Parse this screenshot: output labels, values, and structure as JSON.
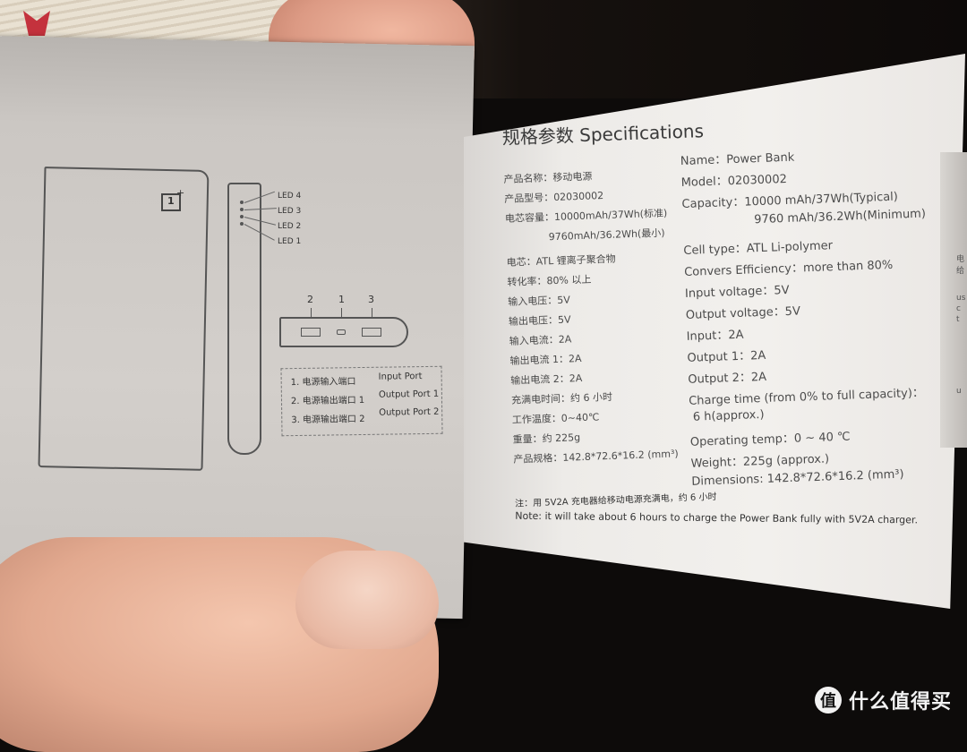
{
  "scene": {
    "description": "Hand holding an open OnePlus power bank manual booklet",
    "colors": {
      "paper": "#efece9",
      "ink": "#4a4a4a",
      "background": "#0d0b0a",
      "skin": "#e2a98f"
    }
  },
  "left_page": {
    "led_labels": [
      "LED 4",
      "LED 3",
      "LED 2",
      "LED 1"
    ],
    "port_numbers": [
      "2",
      "1",
      "3"
    ],
    "legend": [
      {
        "cn": "1. 电源输入端口",
        "en": "Input Port"
      },
      {
        "cn": "2. 电源输出端口 1",
        "en": "Output Port 1"
      },
      {
        "cn": "3. 电源输出端口 2",
        "en": "Output Port 2"
      }
    ],
    "logo_icon": "oneplus-logo-icon"
  },
  "right_page": {
    "title": "规格参数 Specifications",
    "cn_specs": [
      "产品名称：移动电源",
      "产品型号：02030002",
      "电芯容量：10000mAh/37Wh(标准)",
      "9760mAh/36.2Wh(最小)",
      "电芯：ATL 锂离子聚合物",
      "转化率：80% 以上",
      "输入电压：5V",
      "输出电压：5V",
      "输入电流：2A",
      "输出电流 1：2A",
      "输出电流 2：2A",
      "充满电时间：约 6 小时",
      "工作温度：0~40℃",
      "重量：约 225g",
      "产品规格：142.8*72.6*16.2 (mm³)"
    ],
    "en_specs": [
      "Name：Power Bank",
      "Model：02030002",
      "Capacity：10000 mAh/37Wh(Typical)",
      "9760 mAh/36.2Wh(Minimum)",
      "Cell type：ATL Li-polymer",
      "Convers Efficiency：more than 80%",
      "Input voltage：5V",
      "Output voltage：5V",
      "Input：2A",
      "Output 1：2A",
      "Output 2：2A",
      "Charge time (from 0% to full capacity)：",
      "6 h(approx.)",
      "Operating temp：0 ~ 40 ℃",
      "Weight：225g (approx.)",
      "Dimensions: 142.8*72.6*16.2 (mm³)"
    ],
    "note_cn": "注：用 5V2A 充电器给移动电源充满电，约 6 小时",
    "note_en": "Note: it will take about 6 hours to charge the Power Bank fully with 5V2A charger."
  },
  "edge_page_fragments": [
    "电",
    "给",
    "us",
    "c",
    "t",
    "u"
  ],
  "watermark": {
    "badge": "值",
    "text": "什么值得买"
  }
}
